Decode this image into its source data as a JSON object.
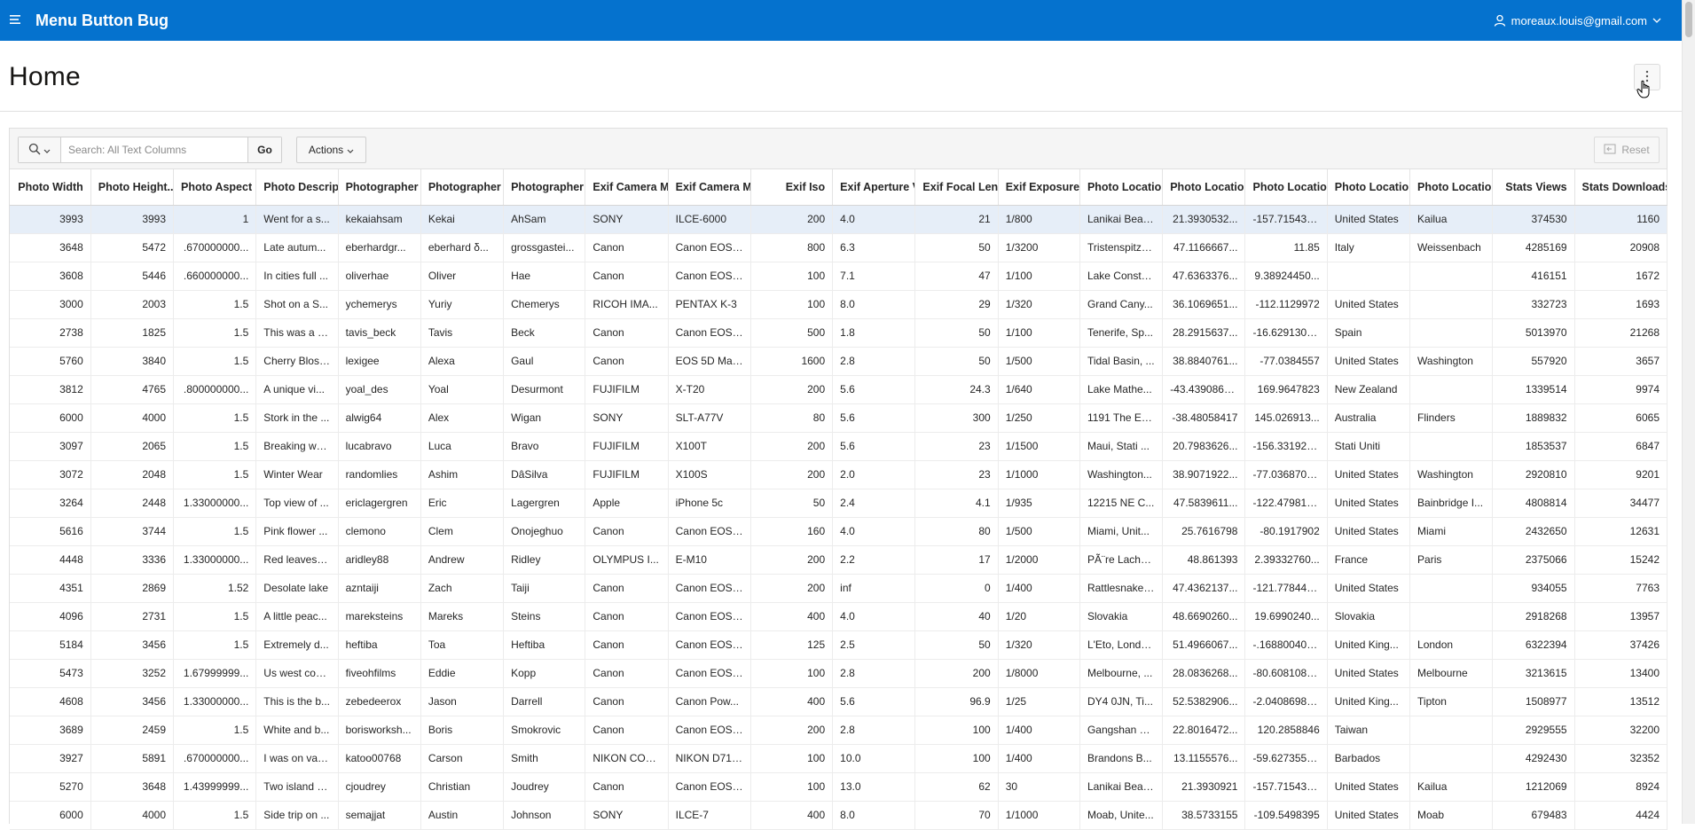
{
  "header": {
    "app_title": "Menu Button Bug",
    "user_email": "moreaux.louis@gmail.com"
  },
  "page": {
    "title": "Home"
  },
  "toolbar": {
    "search_placeholder": "Search: All Text Columns",
    "go_label": "Go",
    "actions_label": "Actions",
    "reset_label": "Reset"
  },
  "colors": {
    "header_bg": "#0572ce",
    "selected_row": "#e6eef8"
  },
  "table": {
    "columns": [
      {
        "label": "Photo Width",
        "align": "r"
      },
      {
        "label": "Photo Height..",
        "align": "r"
      },
      {
        "label": "Photo Aspect R",
        "align": "r"
      },
      {
        "label": "Photo Descripti",
        "align": "l"
      },
      {
        "label": "Photographer U",
        "align": "l"
      },
      {
        "label": "Photographer F",
        "align": "l"
      },
      {
        "label": "Photographer L",
        "align": "l"
      },
      {
        "label": "Exif Camera Ma",
        "align": "l"
      },
      {
        "label": "Exif Camera Mo",
        "align": "l"
      },
      {
        "label": "Exif Iso",
        "align": "r"
      },
      {
        "label": "Exif Aperture V",
        "align": "l"
      },
      {
        "label": "Exif Focal Leng",
        "align": "r"
      },
      {
        "label": "Exif Exposure T",
        "align": "l"
      },
      {
        "label": "Photo Location",
        "align": "l"
      },
      {
        "label": "Photo Location",
        "align": "r"
      },
      {
        "label": "Photo Location",
        "align": "r"
      },
      {
        "label": "Photo Location",
        "align": "l"
      },
      {
        "label": "Photo Location",
        "align": "l"
      },
      {
        "label": "Stats Views",
        "align": "r"
      },
      {
        "label": "Stats Downloads",
        "align": "r"
      }
    ],
    "rows": [
      [
        "3993",
        "3993",
        "1",
        "Went for a s...",
        "kekaiahsam",
        "Kekai",
        "AhSam",
        "SONY",
        "ILCE-6000",
        "200",
        "4.0",
        "21",
        "1/800",
        "Lanikai Beac...",
        "21.3930532...",
        "-157.715435...",
        "United States",
        "Kailua",
        "374530",
        "1160"
      ],
      [
        "3648",
        "5472",
        ".670000000...",
        "Late autum...",
        "eberhardgr...",
        "eberhard δ...",
        "grossgastei...",
        "Canon",
        "Canon EOS ...",
        "800",
        "6.3",
        "50",
        "1/3200",
        "Tristenspitze...",
        "47.1166667...",
        "11.85",
        "Italy",
        "Weissenbach",
        "4285169",
        "20908"
      ],
      [
        "3608",
        "5446",
        ".660000000...",
        "In cities full ...",
        "oliverhae",
        "Oliver",
        "Hae",
        "Canon",
        "Canon EOS ...",
        "100",
        "7.1",
        "47",
        "1/100",
        "Lake Consta...",
        "47.6363376...",
        "9.38924450...",
        "",
        "",
        "416151",
        "1672"
      ],
      [
        "3000",
        "2003",
        "1.5",
        "Shot on a S...",
        "ychemerys",
        "Yuriy",
        "Chemerys",
        "RICOH IMA...",
        "PENTAX K-3",
        "100",
        "8.0",
        "29",
        "1/320",
        "Grand Cany...",
        "36.1069651...",
        "-112.1129972",
        "United States",
        "",
        "332723",
        "1693"
      ],
      [
        "2738",
        "1825",
        "1.5",
        "This was a g...",
        "tavis_beck",
        "Tavis",
        "Beck",
        "Canon",
        "Canon EOS ...",
        "500",
        "1.8",
        "50",
        "1/100",
        "Tenerife, Sp...",
        "28.2915637...",
        "-16.6291304...",
        "Spain",
        "",
        "5013970",
        "21268"
      ],
      [
        "5760",
        "3840",
        "1.5",
        "Cherry Bloss...",
        "lexigee",
        "Alexa",
        "Gaul",
        "Canon",
        "EOS 5D Mar...",
        "1600",
        "2.8",
        "50",
        "1/500",
        "Tidal Basin, ...",
        "38.8840761...",
        "-77.0384557",
        "United States",
        "Washington",
        "557920",
        "3657"
      ],
      [
        "3812",
        "4765",
        ".800000000...",
        "A unique vi...",
        "yoal_des",
        "Yoal",
        "Desurmont",
        "FUJIFILM",
        "X-T20",
        "200",
        "5.6",
        "24.3",
        "1/640",
        "Lake Mathe...",
        "-43.4390860...",
        "169.9647823",
        "New Zealand",
        "",
        "1339514",
        "9974"
      ],
      [
        "6000",
        "4000",
        "1.5",
        "Stork in the ...",
        "alwig64",
        "Alex",
        "Wigan",
        "SONY",
        "SLT-A77V",
        "80",
        "5.6",
        "300",
        "1/250",
        "1191 The Es...",
        "-38.48058417",
        "145.026913...",
        "Australia",
        "Flinders",
        "1889832",
        "6065"
      ],
      [
        "3097",
        "2065",
        "1.5",
        "Breaking wa...",
        "lucabravo",
        "Luca",
        "Bravo",
        "FUJIFILM",
        "X100T",
        "200",
        "5.6",
        "23",
        "1/1500",
        "Maui, Stati ...",
        "20.7983626...",
        "-156.331925...",
        "Stati Uniti",
        "",
        "1853537",
        "6847"
      ],
      [
        "3072",
        "2048",
        "1.5",
        "Winter Wear",
        "randomlies",
        "Ashim",
        "DâSilva",
        "FUJIFILM",
        "X100S",
        "200",
        "2.0",
        "23",
        "1/1000",
        "Washington...",
        "38.9071922...",
        "-77.0368706...",
        "United States",
        "Washington",
        "2920810",
        "9201"
      ],
      [
        "3264",
        "2448",
        "1.33000000...",
        "Top view of ...",
        "ericlagergren",
        "Eric",
        "Lagergren",
        "Apple",
        "iPhone 5c",
        "50",
        "2.4",
        "4.1",
        "1/935",
        "12215 NE C...",
        "47.5839611...",
        "-122.479813...",
        "United States",
        "Bainbridge I...",
        "4808814",
        "34477"
      ],
      [
        "5616",
        "3744",
        "1.5",
        "Pink flower ...",
        "clemono",
        "Clem",
        "Onojeghuo",
        "Canon",
        "Canon EOS ...",
        "160",
        "4.0",
        "80",
        "1/500",
        "Miami, Unit...",
        "25.7616798",
        "-80.1917902",
        "United States",
        "Miami",
        "2432650",
        "12631"
      ],
      [
        "4448",
        "3336",
        "1.33000000...",
        "Red leaves a...",
        "aridley88",
        "Andrew",
        "Ridley",
        "OLYMPUS I...",
        "E-M10",
        "200",
        "2.2",
        "17",
        "1/2000",
        "PÃ¨re Lachai...",
        "48.861393",
        "2.39332760...",
        "France",
        "Paris",
        "2375066",
        "15242"
      ],
      [
        "4351",
        "2869",
        "1.52",
        "Desolate lake",
        "azntaiji",
        "Zach",
        "Taiji",
        "Canon",
        "Canon EOS ...",
        "200",
        "inf",
        "0",
        "1/400",
        "Rattlesnake ...",
        "47.4362137...",
        "-121.778442...",
        "United States",
        "",
        "934055",
        "7763"
      ],
      [
        "4096",
        "2731",
        "1.5",
        "A little peac...",
        "mareksteins",
        "Mareks",
        "Steins",
        "Canon",
        "Canon EOS ...",
        "400",
        "4.0",
        "40",
        "1/20",
        "Slovakia",
        "48.6690260...",
        "19.6990240...",
        "Slovakia",
        "",
        "2918268",
        "13957"
      ],
      [
        "5184",
        "3456",
        "1.5",
        "Extremely d...",
        "heftiba",
        "Toa",
        "Heftiba",
        "Canon",
        "Canon EOS ...",
        "125",
        "2.5",
        "50",
        "1/320",
        "L'Eto, Londo...",
        "51.4966067...",
        "-.168800400...",
        "United King...",
        "London",
        "6322394",
        "37426"
      ],
      [
        "5473",
        "3252",
        "1.67999999...",
        "Us west coa...",
        "fiveohfilms",
        "Eddie",
        "Kopp",
        "Canon",
        "Canon EOS ...",
        "100",
        "2.8",
        "200",
        "1/8000",
        "Melbourne, ...",
        "28.0836268...",
        "-80.6081089...",
        "United States",
        "Melbourne",
        "3213615",
        "13400"
      ],
      [
        "4608",
        "3456",
        "1.33000000...",
        "This is the b...",
        "zebedeerox",
        "Jason",
        "Darrell",
        "Canon",
        "Canon Pow...",
        "400",
        "5.6",
        "96.9",
        "1/25",
        "DY4 0JN, Ti...",
        "52.5382906...",
        "-2.04086989...",
        "United King...",
        "Tipton",
        "1508977",
        "13512"
      ],
      [
        "3689",
        "2459",
        "1.5",
        "White and b...",
        "borisworksh...",
        "Boris",
        "Smokrovic",
        "Canon",
        "Canon EOS ...",
        "200",
        "2.8",
        "100",
        "1/400",
        "Gangshan D...",
        "22.8016472...",
        "120.2858846",
        "Taiwan",
        "",
        "2929555",
        "32200"
      ],
      [
        "3927",
        "5891",
        ".670000000...",
        "I was on vac...",
        "katoo00768",
        "Carson",
        "Smith",
        "NIKON COR...",
        "NIKON D7100",
        "100",
        "10.0",
        "100",
        "1/400",
        "Brandons B...",
        "13.1155576...",
        "-59.6273557...",
        "Barbados",
        "",
        "4292430",
        "32352"
      ],
      [
        "5270",
        "3648",
        "1.43999999...",
        "Two island s...",
        "cjoudrey",
        "Christian",
        "Joudrey",
        "Canon",
        "Canon EOS ...",
        "100",
        "13.0",
        "62",
        "30",
        "Lanikai Beac...",
        "21.3930921",
        "-157.715435...",
        "United States",
        "Kailua",
        "1212069",
        "8924"
      ],
      [
        "6000",
        "4000",
        "1.5",
        "Side trip on ...",
        "semajjat",
        "Austin",
        "Johnson",
        "SONY",
        "ILCE-7",
        "400",
        "8.0",
        "70",
        "1/1000",
        "Moab, Unite...",
        "38.5733155",
        "-109.5498395",
        "United States",
        "Moab",
        "679483",
        "4424"
      ]
    ]
  }
}
